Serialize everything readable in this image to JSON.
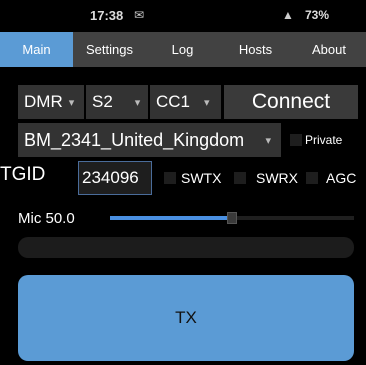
{
  "status_bar": {
    "time": "17:38",
    "msg_icon": "✉",
    "signal_icon": "📶",
    "battery": "73%"
  },
  "tabs": [
    {
      "label": "Main",
      "active": true
    },
    {
      "label": "Settings",
      "active": false
    },
    {
      "label": "Log",
      "active": false
    },
    {
      "label": "Hosts",
      "active": false
    },
    {
      "label": "About",
      "active": false
    }
  ],
  "main": {
    "mode_select": "DMR",
    "slot_select": "S2",
    "cc_select": "CC1",
    "connect_label": "Connect",
    "host_select": "BM_2341_United_Kingdom",
    "private_label": "Private",
    "tgid_label": "TGID",
    "tgid_value": "234096",
    "swtx_label": "SWTX",
    "swrx_label": "SWRX",
    "agc_label": "AGC",
    "mic_label": "Mic 50.0",
    "mic_level": 0.5,
    "tx_label": "TX"
  },
  "colors": {
    "accent": "#5b9bd5",
    "tab_bar": "#424242",
    "background": "#000000",
    "control": "#333333"
  }
}
